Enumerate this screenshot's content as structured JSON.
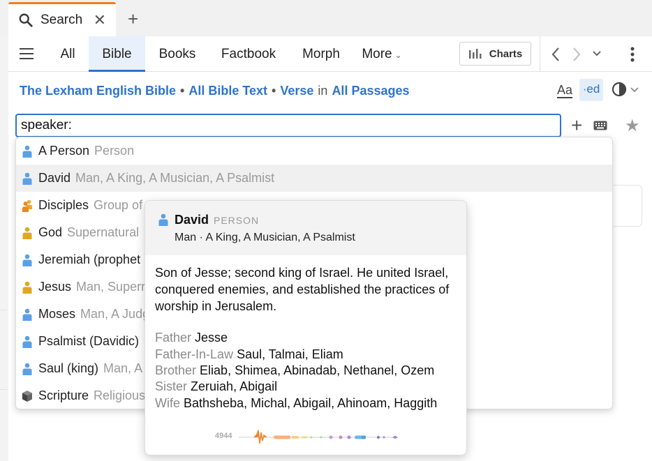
{
  "tab": {
    "label": "Search"
  },
  "nav": {
    "tabs": [
      {
        "label": "All"
      },
      {
        "label": "Bible"
      },
      {
        "label": "Books"
      },
      {
        "label": "Factbook"
      },
      {
        "label": "Morph"
      },
      {
        "label": "More"
      }
    ],
    "active": "Bible",
    "charts_label": "Charts"
  },
  "context": {
    "resource": "The Lexham English Bible",
    "scope": "All Bible Text",
    "unit": "Verse",
    "in": "in",
    "range": "All Passages",
    "aa_label": "Aa",
    "ed_label": "·ed"
  },
  "search": {
    "value": "speaker:"
  },
  "suggestions": [
    {
      "name": "A Person",
      "sub": "Person",
      "icon": "person-icon",
      "color": "#5aa0e6"
    },
    {
      "name": "David",
      "sub": "Man, A King, A Musician, A Psalmist",
      "icon": "person-icon",
      "color": "#5aa0e6"
    },
    {
      "name": "Disciples",
      "sub": "Group of",
      "icon": "group-icon",
      "color": "#f0a63a"
    },
    {
      "name": "God",
      "sub": "Supernatural",
      "icon": "person-icon",
      "color": "#e0a81f"
    },
    {
      "name": "Jeremiah (prophet",
      "sub": "",
      "icon": "person-icon",
      "color": "#5aa0e6"
    },
    {
      "name": "Jesus",
      "sub": "Man, Superr",
      "icon": "person-icon",
      "color": "#e0a81f"
    },
    {
      "name": "Moses",
      "sub": "Man, A Judg",
      "icon": "person-icon",
      "color": "#5aa0e6"
    },
    {
      "name": "Psalmist (Davidic)",
      "sub": "",
      "icon": "person-icon",
      "color": "#5aa0e6"
    },
    {
      "name": "Saul (king)",
      "sub": "Man, A",
      "icon": "person-icon",
      "color": "#5aa0e6"
    },
    {
      "name": "Scripture",
      "sub": "Religious",
      "icon": "cube-icon",
      "color": "#555555"
    }
  ],
  "popover": {
    "title": "David",
    "kind": "PERSON",
    "subtitle": "Man · A King, A Musician, A Psalmist",
    "description": "Son of Jesse; second king of Israel. He united Israel, conquered enemies, and established the practices of worship in Jerusalem.",
    "relations": [
      {
        "key": "Father",
        "value": "Jesse"
      },
      {
        "key": "Father-In-Law",
        "value": "Saul, Talmai, Eliam"
      },
      {
        "key": "Brother",
        "value": "Eliab, Shimea, Abinadab, Nethanel, Ozem"
      },
      {
        "key": "Sister",
        "value": "Zeruiah, Abigail"
      },
      {
        "key": "Wife",
        "value": "Bathsheba, Michal, Abigail, Ahinoam, Haggith"
      }
    ],
    "frequency": "4944"
  },
  "colors": {
    "accent": "#2f73c9",
    "tab_accent": "#ef7d22"
  }
}
